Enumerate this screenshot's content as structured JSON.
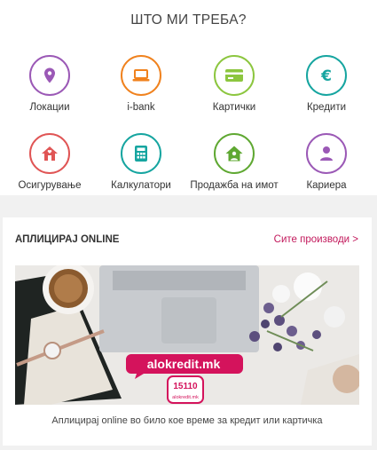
{
  "header": {
    "title": "ШТО МИ ТРЕБА?"
  },
  "services": [
    {
      "label": "Локации",
      "icon": "map-pin-icon",
      "color": "#9b59b6"
    },
    {
      "label": "i-bank",
      "icon": "laptop-icon",
      "color": "#f0821e"
    },
    {
      "label": "Картички",
      "icon": "credit-card-icon",
      "color": "#8cc63f"
    },
    {
      "label": "Кредити",
      "icon": "euro-icon",
      "color": "#16a5a0"
    },
    {
      "label": "Осигурување",
      "icon": "house-icon",
      "color": "#e05555"
    },
    {
      "label": "Калкулатори",
      "icon": "calculator-icon",
      "color": "#16a5a0"
    },
    {
      "label": "Продажба на имот",
      "icon": "house-person-icon",
      "color": "#5fa832"
    },
    {
      "label": "Кариера",
      "icon": "person-icon",
      "color": "#9b59b6"
    }
  ],
  "apply": {
    "title": "АПЛИЦИРАЈ ONLINE",
    "all_products_link": "Сите производи >",
    "banner": {
      "brand": "alokredit.mk",
      "phone": "15110",
      "phone_site": "alokredit.mk"
    },
    "caption": "Аплицирај online во било кое време за кредит или картичка"
  }
}
